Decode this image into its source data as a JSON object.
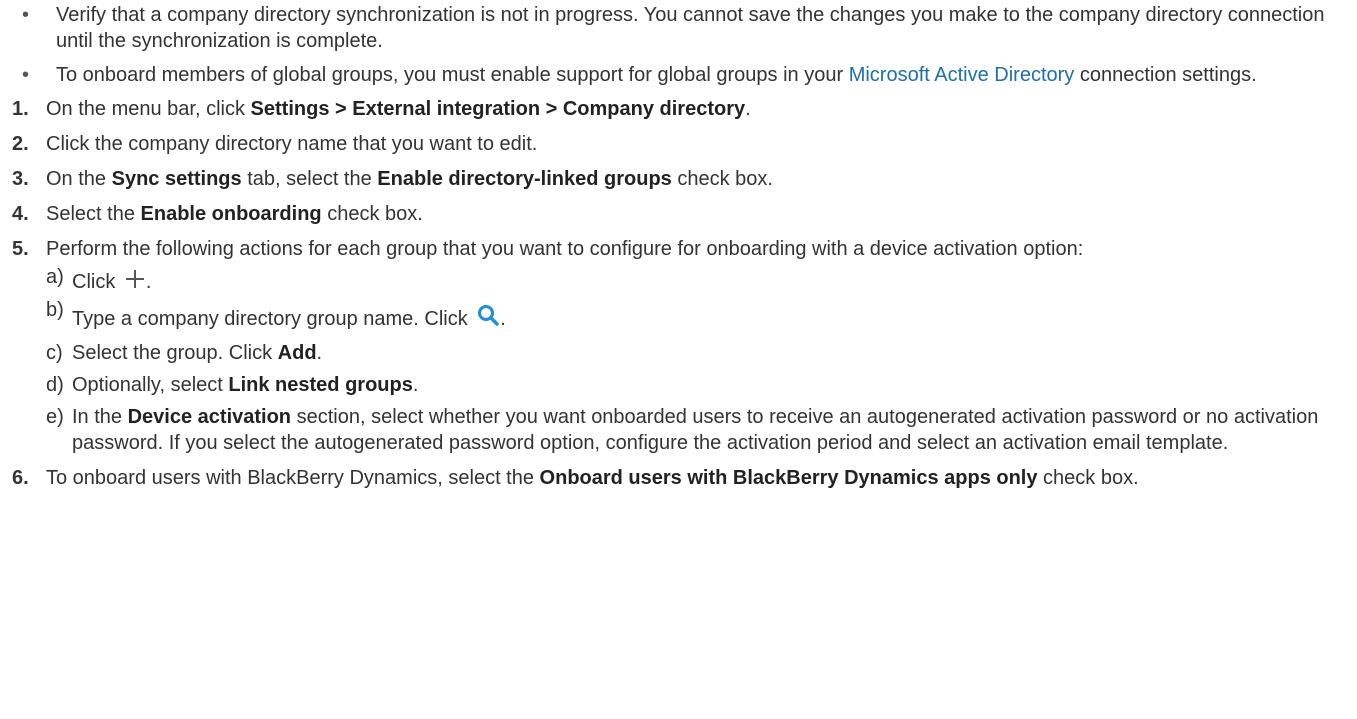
{
  "bullets": [
    {
      "text": "Verify that a company directory synchronization is not in progress. You cannot save the changes you make to the company directory connection until the synchronization is complete."
    },
    {
      "text_before": "To onboard members of global groups, you must enable support for global groups in your ",
      "link": "Microsoft Active Directory",
      "text_after": " connection settings."
    }
  ],
  "steps": {
    "s1": {
      "num": "1.",
      "pre": "On the menu bar, click ",
      "bold": "Settings > External integration > Company directory",
      "post": "."
    },
    "s2": {
      "num": "2.",
      "text": "Click the company directory name that you want to edit."
    },
    "s3": {
      "num": "3.",
      "pre": "On the ",
      "bold1": "Sync settings",
      "mid": " tab, select the ",
      "bold2": "Enable directory-linked groups",
      "post": " check box."
    },
    "s4": {
      "num": "4.",
      "pre": "Select the ",
      "bold": "Enable onboarding",
      "post": " check box."
    },
    "s5": {
      "num": "5.",
      "text": "Perform the following actions for each group that you want to configure for onboarding with a device activation option:",
      "substeps": {
        "a": {
          "mark": "a)",
          "pre": "Click ",
          "post": ".",
          "icon": "plus-icon"
        },
        "b": {
          "mark": "b)",
          "pre": "Type a company directory group name. Click ",
          "post": ".",
          "icon": "search-icon"
        },
        "c": {
          "mark": "c)",
          "pre": "Select the group. Click ",
          "bold": "Add",
          "post": "."
        },
        "d": {
          "mark": "d)",
          "pre": "Optionally, select ",
          "bold": "Link nested groups",
          "post": "."
        },
        "e": {
          "mark": "e)",
          "pre": "In the ",
          "bold": "Device activation",
          "post": " section, select whether you want onboarded users to receive an autogenerated activation password or no activation password. If you select the autogenerated password option, configure the activation period and select an activation email template."
        }
      }
    },
    "s6": {
      "num": "6.",
      "pre": "To onboard users with BlackBerry Dynamics, select the ",
      "bold": "Onboard users with BlackBerry Dynamics apps only",
      "post": " check box."
    }
  },
  "colors": {
    "link": "#1c6fa8",
    "text": "#333333",
    "icon": "#1c8fd6"
  }
}
